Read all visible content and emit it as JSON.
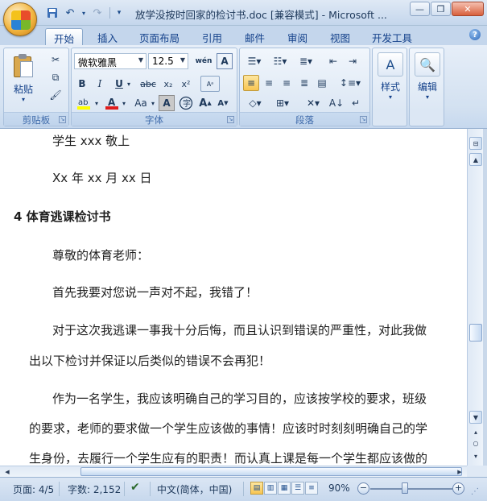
{
  "window": {
    "title": "放学没按时回家的检讨书.doc [兼容模式] - Microsoft ...",
    "minimize_icon": "minimize-icon",
    "restore_icon": "restore-icon",
    "close_icon": "close-icon"
  },
  "quick_access": {
    "save_icon": "save-icon",
    "undo_icon": "undo-icon",
    "redo_icon": "redo-icon",
    "customize_icon": "chevron-down-icon"
  },
  "tabs": [
    {
      "label": "开始",
      "active": true
    },
    {
      "label": "插入"
    },
    {
      "label": "页面布局"
    },
    {
      "label": "引用"
    },
    {
      "label": "邮件"
    },
    {
      "label": "审阅"
    },
    {
      "label": "视图"
    },
    {
      "label": "开发工具"
    }
  ],
  "ribbon": {
    "clipboard": {
      "label": "剪贴板",
      "paste_label": "粘贴"
    },
    "font": {
      "label": "字体",
      "font_name": "微软雅黑",
      "font_size": "12.5",
      "wen_label": "wén\n文",
      "bold": "B",
      "italic": "I",
      "underline": "U",
      "strike": "abc",
      "subscript": "x₂",
      "superscript": "x²",
      "case": "Aa",
      "grow": "A",
      "shrink": "A"
    },
    "paragraph": {
      "label": "段落"
    },
    "styles": {
      "label": "样式"
    },
    "editing": {
      "label": "编辑"
    }
  },
  "document": {
    "lines": [
      "学生 xxx 敬上",
      "Xx 年 xx 月 xx 日",
      "4 体育逃课检讨书",
      "尊敬的体育老师：",
      "首先我要对您说一声对不起，我错了！",
      "对于这次我逃课一事我十分后悔，而且认识到错误的严重性，对此我做",
      "出以下检讨并保证以后类似的错误不会再犯！",
      "作为一名学生，我应该明确自己的学习目的，应该按学校的要求，班级",
      "的要求，老师的要求做一个学生应该做的事情！应该时时刻刻明确自己的学",
      "生身份，去履行一个学生应有的职责！而认真上课是每一个学生都应该做的"
    ]
  },
  "status": {
    "page": "页面: 4/5",
    "words": "字数: 2,152",
    "language": "中文(简体，中国)",
    "zoom": "90%",
    "zoom_percent": 90
  },
  "colors": {
    "accent": "#15428b",
    "highlight": "#f8c552"
  }
}
